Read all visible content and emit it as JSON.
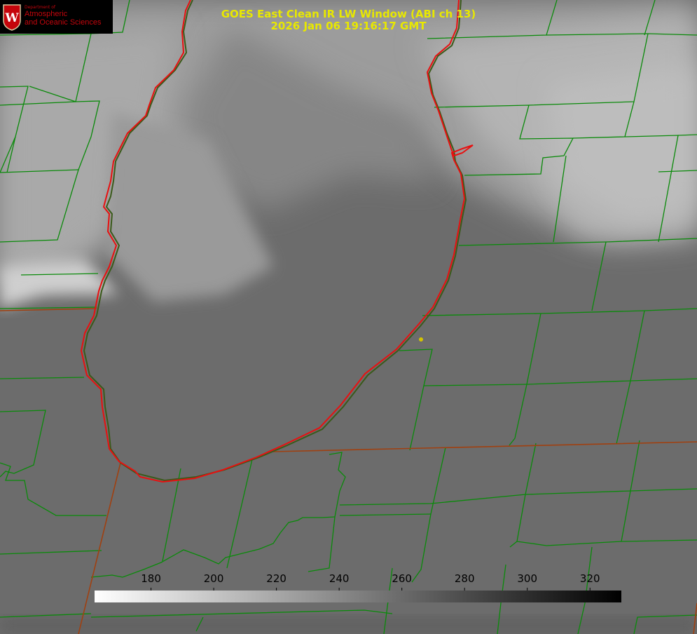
{
  "title": {
    "line1": "GOES East Clean IR LW Window (ABI ch 13)",
    "line2": "2026 Jan 06 19:16:17 GMT"
  },
  "logo": {
    "department": "Department of",
    "name_line1": "Atmospheric",
    "name_line2": "and Oceanic Sciences",
    "seal_letter": "W",
    "color": "#c5050c"
  },
  "colorbar": {
    "ticks": [
      "180",
      "200",
      "220",
      "240",
      "260",
      "280",
      "300",
      "320"
    ],
    "min": 162,
    "max": 330,
    "low_color": "#ffffff",
    "high_color": "#000000"
  },
  "map": {
    "county_line_color": "#0a8a0a",
    "coastline_color": "#e81010",
    "state_line_color": "#a04010",
    "marker_color": "#d4c400"
  }
}
